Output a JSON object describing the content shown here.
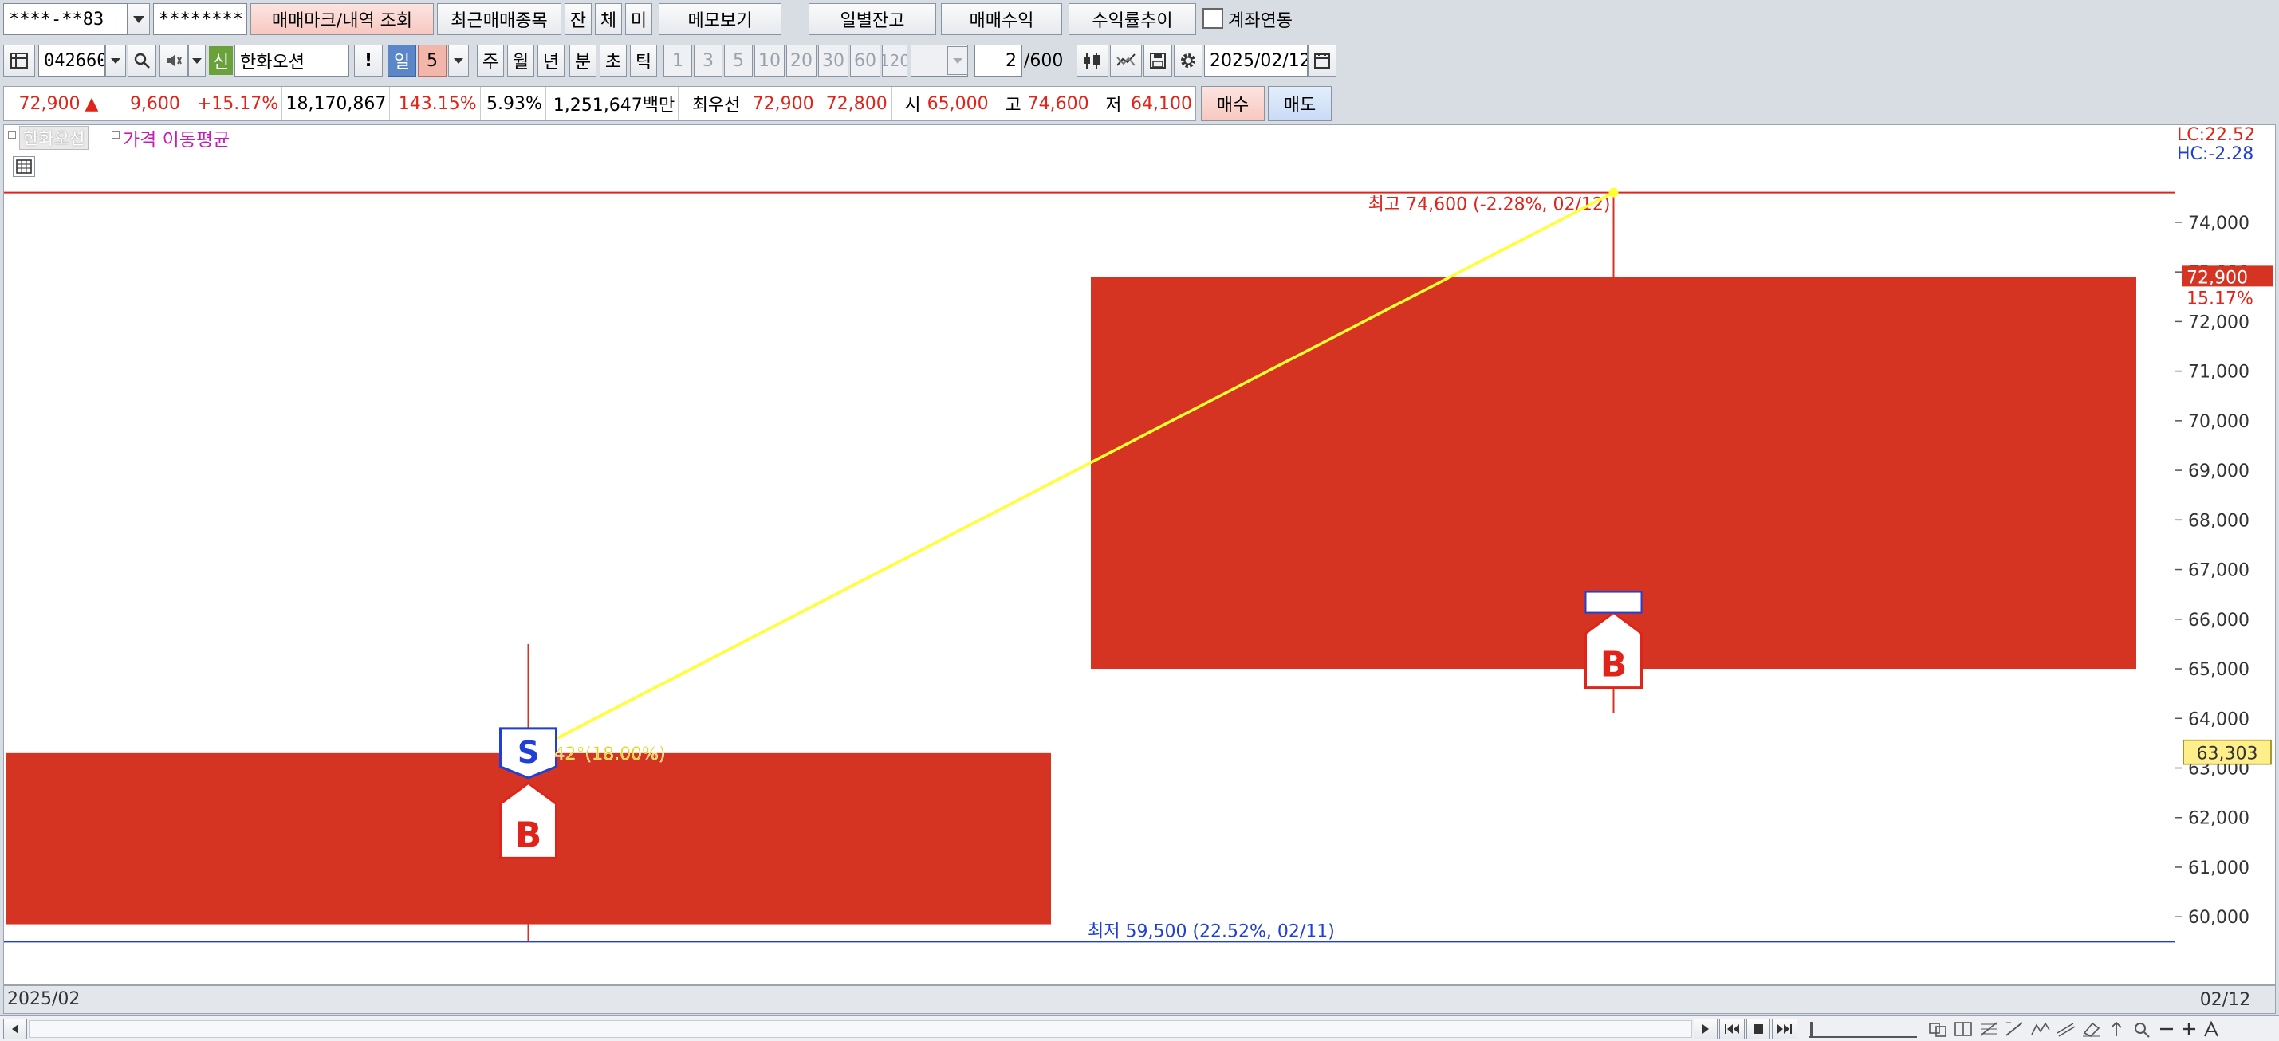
{
  "toolbar1": {
    "account": "****-**83",
    "password": "********",
    "trade_mark_btn": "매매마크/내역 조회",
    "recent_btn": "최근매매종목",
    "balance_short": "잔",
    "filled_short": "체",
    "unfilled_short": "미",
    "memo_btn": "메모보기",
    "daily_balance_btn": "일별잔고",
    "trade_profit_btn": "매매수익",
    "return_trend_btn": "수익률추이",
    "account_link_label": "계좌연동"
  },
  "toolbar2": {
    "code": "042660",
    "credit_badge": "신",
    "stock_name": "한화오션",
    "alert": "!",
    "period_day": "일",
    "period_value": "5",
    "period_week": "주",
    "period_month": "월",
    "period_year": "년",
    "period_minute": "분",
    "period_second": "초",
    "period_tick": "틱",
    "intervals": [
      "1",
      "3",
      "5",
      "10",
      "20",
      "30",
      "60",
      "120"
    ],
    "page_current": "2",
    "page_total": "/600",
    "date": "2025/02/12"
  },
  "quote": {
    "price": "72,900",
    "change_arrow": "▲",
    "change": "9,600",
    "change_pct": "+15.17%",
    "volume": "18,170,867",
    "volume_ratio": "143.15%",
    "turnover": "5.93%",
    "amount": "1,251,647백만",
    "best_label": "최우선",
    "best_ask": "72,900",
    "best_bid": "72,800",
    "open_label": "시",
    "open": "65,000",
    "high_label": "고",
    "high": "74,600",
    "low_label": "저",
    "low": "64,100",
    "buy_btn": "매수",
    "sell_btn": "매도"
  },
  "chart_header": {
    "series_tag": "한화오션",
    "ma_label": "가격 이동평균",
    "lc": "LC:22.52",
    "hc": "HC:-2.28"
  },
  "chart_data": {
    "type": "candlestick",
    "ylim": [
      59200,
      75300
    ],
    "y_ticks": [
      60000,
      61000,
      62000,
      63000,
      64000,
      65000,
      66000,
      67000,
      68000,
      69000,
      70000,
      71000,
      72000,
      73000,
      74000
    ],
    "y_tick_labels": [
      "60,000",
      "61,000",
      "62,000",
      "63,000",
      "64,000",
      "65,000",
      "66,000",
      "67,000",
      "68,000",
      "69,000",
      "70,000",
      "71,000",
      "72,000",
      "73,000",
      "74,000"
    ],
    "candles": [
      {
        "date": "02/11",
        "open": 63300,
        "close": 59850,
        "high": 65500,
        "low": 59500,
        "color": "#d63422"
      },
      {
        "date": "02/12",
        "open": 65000,
        "close": 72900,
        "high": 74600,
        "low": 64100,
        "color": "#d63422"
      }
    ],
    "high_line": {
      "value": 74600,
      "label": "최고 74,600 (-2.28%, 02/12)",
      "color": "#e0241a"
    },
    "low_line": {
      "value": 59500,
      "label": "최저 59,500 (22.52%, 02/11)",
      "color": "#1f3fd6"
    },
    "trend_line": {
      "from_value": 63300,
      "to_value": 74600,
      "label": "42°(18.00%)",
      "color": "#ffff33"
    },
    "markers": [
      {
        "type": "S",
        "candle": 0,
        "value": 63300,
        "color": "#1f3fd6"
      },
      {
        "type": "B",
        "candle": 0,
        "value": 62600,
        "color": "#e0241a"
      },
      {
        "type": "B",
        "candle": 1,
        "value": 65650,
        "color": "#e0241a"
      }
    ],
    "last_price_tag": {
      "value": 72900,
      "label": "72,900",
      "pct": "15.17%",
      "color": "#d63422"
    },
    "crosshair_tag": {
      "value": 63303,
      "label": "63,303",
      "color": "#ffef8a"
    },
    "x_start_label": "2025/02",
    "x_end_label": "02/12"
  }
}
